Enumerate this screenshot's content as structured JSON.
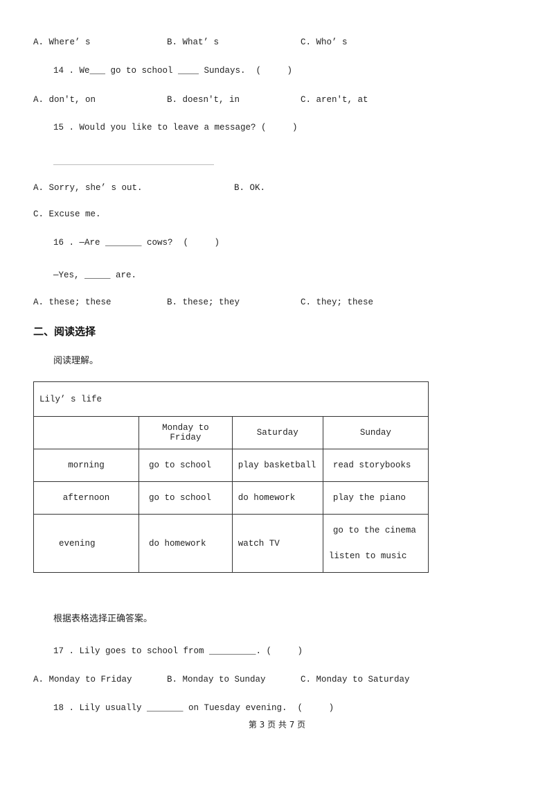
{
  "q13": {
    "options": [
      "A. Where’ s",
      "B. What’ s",
      "C. Who’ s"
    ]
  },
  "q14": {
    "stem": "14 . We___ go to school ____ Sundays.  (     )",
    "options": [
      "A. don't, on",
      "B. doesn't, in",
      "C. aren't, at"
    ]
  },
  "q15": {
    "stem": "15 . Would you like to leave a message? (     )",
    "options": [
      "A. Sorry, she’ s out.",
      "B. OK.",
      "C. Excuse me."
    ]
  },
  "q16": {
    "stem": "16 . —Are _______ cows?  (     )",
    "line2": "—Yes, _____ are.",
    "options": [
      "A. these; these",
      "B. these; they",
      "C. they; these"
    ]
  },
  "section2": {
    "title": "二、阅读选择",
    "instruction": "阅读理解。"
  },
  "table": {
    "title": "Lily’ s life",
    "headers": [
      "",
      "Monday to Friday",
      "Saturday",
      "Sunday"
    ],
    "rows": [
      {
        "label": "morning",
        "cells": [
          "go to school",
          "play basketball",
          "read storybooks"
        ]
      },
      {
        "label": "afternoon",
        "cells": [
          "go to school",
          "do homework",
          "play the piano"
        ]
      },
      {
        "label": "evening",
        "cells": [
          "do homework",
          "watch TV",
          "go to the cinema"
        ],
        "extra": "listen to music"
      }
    ]
  },
  "instruction2": "根据表格选择正确答案。",
  "q17": {
    "stem": "17 . Lily goes to school from _________. (     )",
    "options": [
      "A. Monday to Friday",
      "B. Monday to Sunday",
      "C. Monday to Saturday"
    ]
  },
  "q18": {
    "stem": "18 . Lily usually _______ on Tuesday evening.  (     )"
  },
  "footer": {
    "text": "第 3 页 共 7 页"
  }
}
